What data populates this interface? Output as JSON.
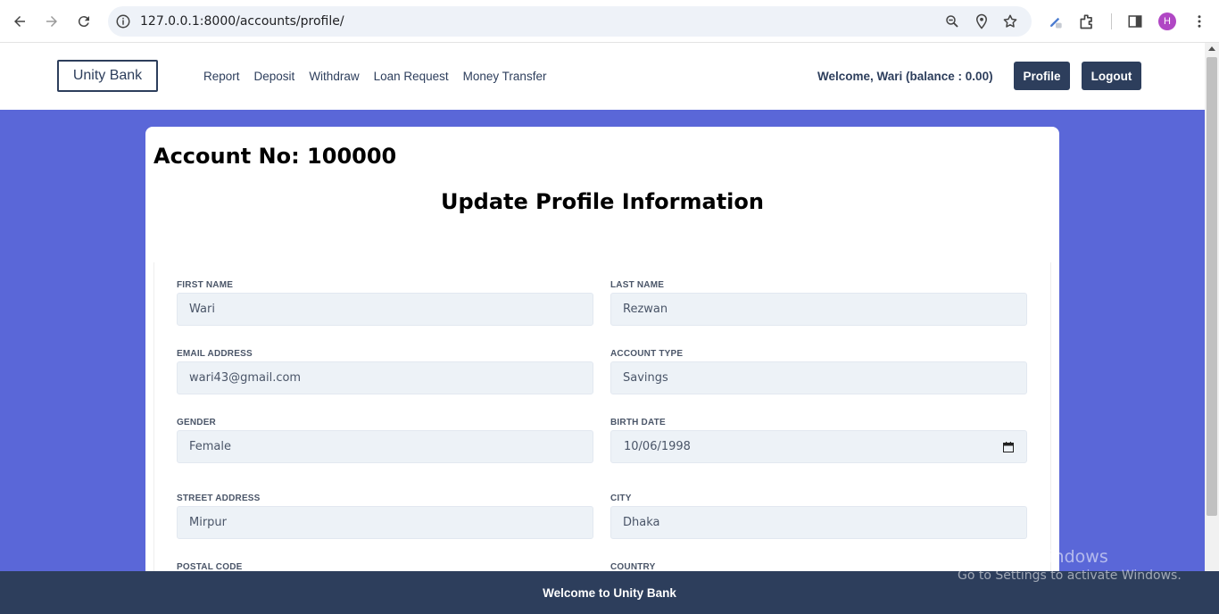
{
  "browser": {
    "url": "127.0.0.1:8000/accounts/profile/",
    "profile_initial": "H"
  },
  "header": {
    "brand": "Unity Bank",
    "nav": [
      "Report",
      "Deposit",
      "Withdraw",
      "Loan Request",
      "Money Transfer"
    ],
    "welcome": "Welcome, Wari (balance : 0.00)",
    "profile_button": "Profile",
    "logout_button": "Logout"
  },
  "page": {
    "account_no": "Account No: 100000",
    "title": "Update Profile Information"
  },
  "form": {
    "first_name": {
      "label": "FIRST NAME",
      "value": "Wari"
    },
    "last_name": {
      "label": "LAST NAME",
      "value": "Rezwan"
    },
    "email": {
      "label": "EMAIL ADDRESS",
      "value": "wari43@gmail.com"
    },
    "account_type": {
      "label": "ACCOUNT TYPE",
      "value": "Savings"
    },
    "gender": {
      "label": "GENDER",
      "value": "Female"
    },
    "birth_date": {
      "label": "BIRTH DATE",
      "value": "10/06/1998"
    },
    "street_address": {
      "label": "STREET ADDRESS",
      "value": "Mirpur"
    },
    "city": {
      "label": "CITY",
      "value": "Dhaka"
    },
    "postal_code": {
      "label": "POSTAL CODE"
    },
    "country": {
      "label": "COUNTRY"
    }
  },
  "footer": {
    "text": "Welcome to Unity Bank"
  },
  "watermark": {
    "line1": "Activate Windows",
    "line2": "Go to Settings to activate Windows."
  },
  "colors": {
    "primary": "#2d3e5c",
    "main_bg": "#5a67d8",
    "input_bg": "#edf2f7"
  }
}
